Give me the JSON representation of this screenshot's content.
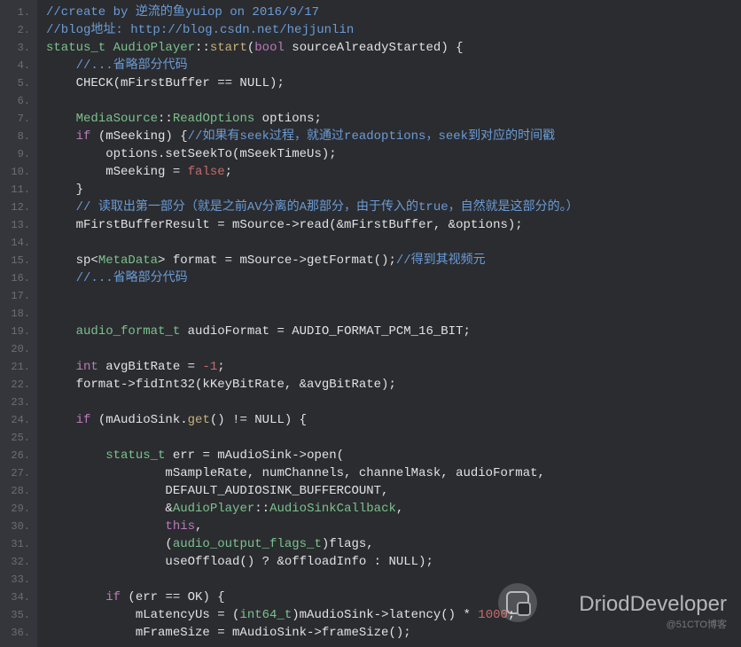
{
  "watermark": {
    "main": "DriodDeveloper",
    "sub": "@51CTO博客"
  },
  "lines": [
    {
      "n": 1,
      "tokens": [
        [
          "c-comment",
          "//create by 逆流的鱼yuiop on 2016/9/17"
        ]
      ]
    },
    {
      "n": 2,
      "tokens": [
        [
          "c-comment",
          "//blog地址: http://blog.csdn.net/hejjunlin"
        ]
      ]
    },
    {
      "n": 3,
      "tokens": [
        [
          "c-type",
          "status_t "
        ],
        [
          "c-type",
          "AudioPlayer"
        ],
        [
          "c-op",
          "::"
        ],
        [
          "c-func",
          "start"
        ],
        [
          "c-op",
          "("
        ],
        [
          "c-keyword",
          "bool"
        ],
        [
          "c-op",
          " sourceAlreadyStarted) {"
        ]
      ]
    },
    {
      "n": 4,
      "tokens": [
        [
          "c-op",
          "    "
        ],
        [
          "c-comment",
          "//...省略部分代码"
        ]
      ]
    },
    {
      "n": 5,
      "tokens": [
        [
          "c-op",
          "    CHECK(mFirstBuffer == NULL);"
        ]
      ]
    },
    {
      "n": 6,
      "tokens": [
        [
          "c-op",
          ""
        ]
      ]
    },
    {
      "n": 7,
      "tokens": [
        [
          "c-op",
          "    "
        ],
        [
          "c-type",
          "MediaSource"
        ],
        [
          "c-op",
          "::"
        ],
        [
          "c-type",
          "ReadOptions"
        ],
        [
          "c-op",
          " options;"
        ]
      ]
    },
    {
      "n": 8,
      "tokens": [
        [
          "c-op",
          "    "
        ],
        [
          "c-keyword",
          "if"
        ],
        [
          "c-op",
          " (mSeeking) {"
        ],
        [
          "c-comment",
          "//如果有seek过程，就通过readoptions，seek到对应的时间戳"
        ]
      ]
    },
    {
      "n": 9,
      "tokens": [
        [
          "c-op",
          "        options.setSeekTo(mSeekTimeUs);"
        ]
      ]
    },
    {
      "n": 10,
      "tokens": [
        [
          "c-op",
          "        mSeeking = "
        ],
        [
          "c-bool",
          "false"
        ],
        [
          "c-op",
          ";"
        ]
      ]
    },
    {
      "n": 11,
      "tokens": [
        [
          "c-op",
          "    }"
        ]
      ]
    },
    {
      "n": 12,
      "tokens": [
        [
          "c-op",
          "    "
        ],
        [
          "c-comment",
          "// 读取出第一部分（就是之前AV分离的A那部分，由于传入的true，自然就是这部分的。）"
        ]
      ]
    },
    {
      "n": 13,
      "tokens": [
        [
          "c-op",
          "    mFirstBufferResult = mSource->read(&mFirstBuffer, &options);"
        ]
      ]
    },
    {
      "n": 14,
      "tokens": [
        [
          "c-op",
          ""
        ]
      ]
    },
    {
      "n": 15,
      "tokens": [
        [
          "c-op",
          "    sp<"
        ],
        [
          "c-type",
          "MetaData"
        ],
        [
          "c-op",
          "> format = mSource->getFormat();"
        ],
        [
          "c-comment",
          "//得到其视频元"
        ]
      ]
    },
    {
      "n": 16,
      "tokens": [
        [
          "c-op",
          "    "
        ],
        [
          "c-comment",
          "//...省略部分代码"
        ]
      ]
    },
    {
      "n": 17,
      "tokens": [
        [
          "c-op",
          ""
        ]
      ]
    },
    {
      "n": 18,
      "tokens": [
        [
          "c-op",
          ""
        ]
      ]
    },
    {
      "n": 19,
      "tokens": [
        [
          "c-op",
          "    "
        ],
        [
          "c-type",
          "audio_format_t"
        ],
        [
          "c-op",
          " audioFormat = AUDIO_FORMAT_PCM_16_BIT;"
        ]
      ]
    },
    {
      "n": 20,
      "tokens": [
        [
          "c-op",
          ""
        ]
      ]
    },
    {
      "n": 21,
      "tokens": [
        [
          "c-op",
          "    "
        ],
        [
          "c-keyword",
          "int"
        ],
        [
          "c-op",
          " avgBitRate = "
        ],
        [
          "c-number",
          "-1"
        ],
        [
          "c-op",
          ";"
        ]
      ]
    },
    {
      "n": 22,
      "tokens": [
        [
          "c-op",
          "    format->fidInt32(kKeyBitRate, &avgBitRate);"
        ]
      ]
    },
    {
      "n": 23,
      "tokens": [
        [
          "c-op",
          ""
        ]
      ]
    },
    {
      "n": 24,
      "tokens": [
        [
          "c-op",
          "    "
        ],
        [
          "c-keyword",
          "if"
        ],
        [
          "c-op",
          " (mAudioSink."
        ],
        [
          "c-func",
          "get"
        ],
        [
          "c-op",
          "() != NULL) {"
        ]
      ]
    },
    {
      "n": 25,
      "tokens": [
        [
          "c-op",
          ""
        ]
      ]
    },
    {
      "n": 26,
      "tokens": [
        [
          "c-op",
          "        "
        ],
        [
          "c-type",
          "status_t"
        ],
        [
          "c-op",
          " err = mAudioSink->open("
        ]
      ]
    },
    {
      "n": 27,
      "tokens": [
        [
          "c-op",
          "                mSampleRate, numChannels, channelMask, audioFormat,"
        ]
      ]
    },
    {
      "n": 28,
      "tokens": [
        [
          "c-op",
          "                DEFAULT_AUDIOSINK_BUFFERCOUNT,"
        ]
      ]
    },
    {
      "n": 29,
      "tokens": [
        [
          "c-op",
          "                &"
        ],
        [
          "c-type",
          "AudioPlayer"
        ],
        [
          "c-op",
          "::"
        ],
        [
          "c-type",
          "AudioSinkCallback"
        ],
        [
          "c-op",
          ","
        ]
      ]
    },
    {
      "n": 30,
      "tokens": [
        [
          "c-op",
          "                "
        ],
        [
          "c-keyword",
          "this"
        ],
        [
          "c-op",
          ","
        ]
      ]
    },
    {
      "n": 31,
      "tokens": [
        [
          "c-op",
          "                ("
        ],
        [
          "c-type",
          "audio_output_flags_t"
        ],
        [
          "c-op",
          ")flags,"
        ]
      ]
    },
    {
      "n": 32,
      "tokens": [
        [
          "c-op",
          "                useOffload() ? &offloadInfo : NULL);"
        ]
      ]
    },
    {
      "n": 33,
      "tokens": [
        [
          "c-op",
          ""
        ]
      ]
    },
    {
      "n": 34,
      "tokens": [
        [
          "c-op",
          "        "
        ],
        [
          "c-keyword",
          "if"
        ],
        [
          "c-op",
          " (err == OK) {"
        ]
      ]
    },
    {
      "n": 35,
      "tokens": [
        [
          "c-op",
          "            mLatencyUs = ("
        ],
        [
          "c-type",
          "int64_t"
        ],
        [
          "c-op",
          ")mAudioSink->latency() * "
        ],
        [
          "c-number",
          "1000"
        ],
        [
          "c-op",
          ";"
        ]
      ]
    },
    {
      "n": 36,
      "tokens": [
        [
          "c-op",
          "            mFrameSize = mAudioSink->frameSize();"
        ]
      ]
    }
  ]
}
